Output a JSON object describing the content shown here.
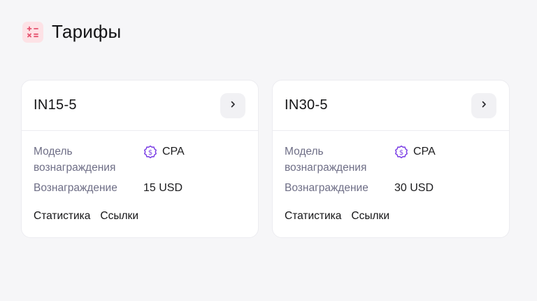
{
  "page": {
    "title": "Тарифы",
    "icon": "calculator-icon",
    "icon_color": "#e5536f"
  },
  "cards": [
    {
      "name": "IN15-5",
      "model_label": "Модель вознаграждения",
      "model_value": "CPA",
      "model_icon": "dollar-badge-icon",
      "reward_label": "Вознаграждение",
      "reward_value": "15 USD",
      "stats_link": "Статистика",
      "links_link": "Ссылки"
    },
    {
      "name": "IN30-5",
      "model_label": "Модель вознаграждения",
      "model_value": "CPA",
      "model_icon": "dollar-badge-icon",
      "reward_label": "Вознаграждение",
      "reward_value": "30 USD",
      "stats_link": "Статистика",
      "links_link": "Ссылки"
    }
  ],
  "colors": {
    "accent_purple": "#7b3fe4",
    "label_gray": "#6e6e86"
  }
}
